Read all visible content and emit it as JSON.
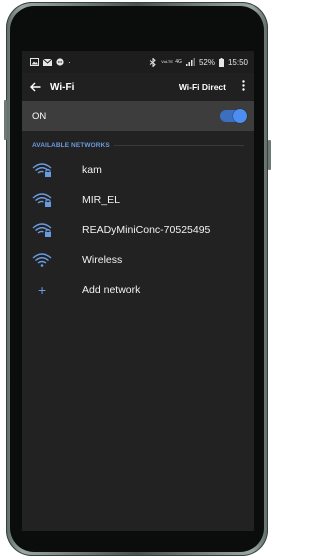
{
  "status_bar": {
    "left_icons": [
      "image-icon",
      "mail-icon",
      "chat-icon",
      "dot-icon"
    ],
    "network_labels": [
      "VoLTE",
      "4G"
    ],
    "battery_percent": "52%",
    "time": "15:50"
  },
  "app_bar": {
    "back_icon": "back-arrow-icon",
    "title": "Wi-Fi",
    "wifi_direct_label": "Wi-Fi Direct",
    "more_icon": "more-vert-icon"
  },
  "toggle_row": {
    "label": "ON",
    "enabled": true
  },
  "section_header": "AVAILABLE NETWORKS",
  "networks": [
    {
      "ssid": "kam",
      "locked": true
    },
    {
      "ssid": "MIR_EL",
      "locked": true
    },
    {
      "ssid": "READyMiniConc-70525495",
      "locked": true
    },
    {
      "ssid": "Wireless",
      "locked": false
    }
  ],
  "add_network_label": "Add network",
  "colors": {
    "accent": "#6a9be0",
    "toggle_on": "#4c8ff0",
    "background": "#222222",
    "highlight_row": "#3d3d3d"
  }
}
